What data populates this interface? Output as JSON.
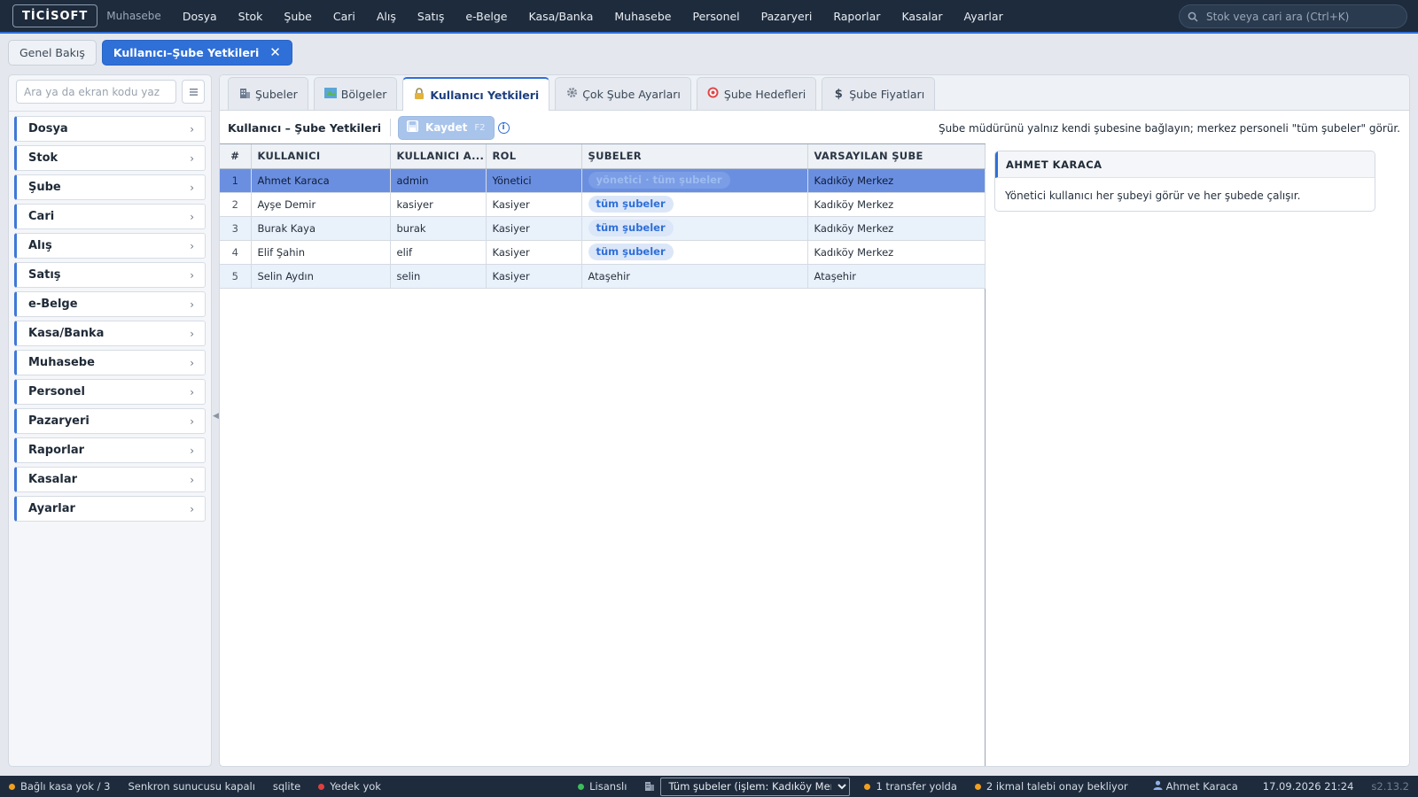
{
  "app": {
    "logo": "TİCİSOFT",
    "module": "Muhasebe"
  },
  "topmenu": [
    "Dosya",
    "Stok",
    "Şube",
    "Cari",
    "Alış",
    "Satış",
    "e-Belge",
    "Kasa/Banka",
    "Muhasebe",
    "Personel",
    "Pazaryeri",
    "Raporlar",
    "Kasalar",
    "Ayarlar"
  ],
  "top_search": {
    "placeholder": "Stok veya cari ara (Ctrl+K)",
    "icon": "search-icon"
  },
  "page_tabs": [
    {
      "label": "Genel Bakış",
      "active": false
    },
    {
      "label": "Kullanıcı–Şube Yetkileri",
      "active": true,
      "close": "✕"
    }
  ],
  "sidebar": {
    "search_placeholder": "Ara ya da ekran kodu yaz",
    "items": [
      "Dosya",
      "Stok",
      "Şube",
      "Cari",
      "Alış",
      "Satış",
      "e-Belge",
      "Kasa/Banka",
      "Muhasebe",
      "Personel",
      "Pazaryeri",
      "Raporlar",
      "Kasalar",
      "Ayarlar"
    ]
  },
  "subtabs": [
    {
      "label": "Şubeler",
      "icon": "building-icon",
      "active": false
    },
    {
      "label": "Bölgeler",
      "icon": "map-icon",
      "active": false
    },
    {
      "label": "Kullanıcı Yetkileri",
      "icon": "lock-icon",
      "active": true
    },
    {
      "label": "Çok Şube Ayarları",
      "icon": "gear-icon",
      "active": false
    },
    {
      "label": "Şube Hedefleri",
      "icon": "target-icon",
      "active": false
    },
    {
      "label": "Şube Fiyatları",
      "icon": "dollar-icon",
      "active": false
    }
  ],
  "toolbar": {
    "title": "Kullanıcı – Şube Yetkileri",
    "save_label": "Kaydet",
    "save_key": "F2",
    "hint": "Şube müdürünü yalnız kendi şubesine bağlayın; merkez personeli \"tüm şubeler\" görür."
  },
  "grid": {
    "columns": [
      "#",
      "KULLANICI",
      "KULLANICI A...",
      "ROL",
      "ŞUBELER",
      "VARSAYILAN ŞUBE"
    ],
    "rows": [
      {
        "no": "1",
        "user": "Ahmet Karaca",
        "username": "admin",
        "role": "Yönetici",
        "branches": "yönetici · tüm şubeler",
        "chip": true,
        "default": "Kadıköy Merkez",
        "selected": true
      },
      {
        "no": "2",
        "user": "Ayşe Demir",
        "username": "kasiyer",
        "role": "Kasiyer",
        "branches": "tüm şubeler",
        "chip": true,
        "default": "Kadıköy Merkez"
      },
      {
        "no": "3",
        "user": "Burak Kaya",
        "username": "burak",
        "role": "Kasiyer",
        "branches": "tüm şubeler",
        "chip": true,
        "default": "Kadıköy Merkez"
      },
      {
        "no": "4",
        "user": "Elif Şahin",
        "username": "elif",
        "role": "Kasiyer",
        "branches": "tüm şubeler",
        "chip": true,
        "default": "Kadıköy Merkez"
      },
      {
        "no": "5",
        "user": "Selin Aydın",
        "username": "selin",
        "role": "Kasiyer",
        "branches": "Ataşehir",
        "chip": false,
        "default": "Ataşehir"
      }
    ]
  },
  "detail": {
    "title": "AHMET KARACA",
    "body": "Yönetici kullanıcı her şubeyi görür ve her şubede çalışır."
  },
  "status": {
    "left": [
      {
        "text": "Bağlı kasa yok / 3",
        "dot": "#f0a020"
      },
      {
        "text": "Senkron sunucusu kapalı",
        "dot": null
      },
      {
        "text": "sqlite",
        "dot": null
      },
      {
        "text": "Yedek yok",
        "dot": "#e04040"
      }
    ],
    "licensed": "Lisanslı",
    "branch_select": "Tüm şubeler (işlem: Kadıköy Merkez)",
    "transfer": "1 transfer yolda",
    "restock": "2 ikmal talebi onay bekliyor",
    "user": "Ahmet Karaca",
    "datetime": "17.09.2026 21:24",
    "version": "s2.13.2"
  },
  "colors": {
    "accent": "#2f6fd8",
    "topbar": "#1e2b3c",
    "selected_row": "#6b8fe0",
    "ok": "#3cbf5a",
    "warn": "#f0a020",
    "error": "#e04040"
  }
}
